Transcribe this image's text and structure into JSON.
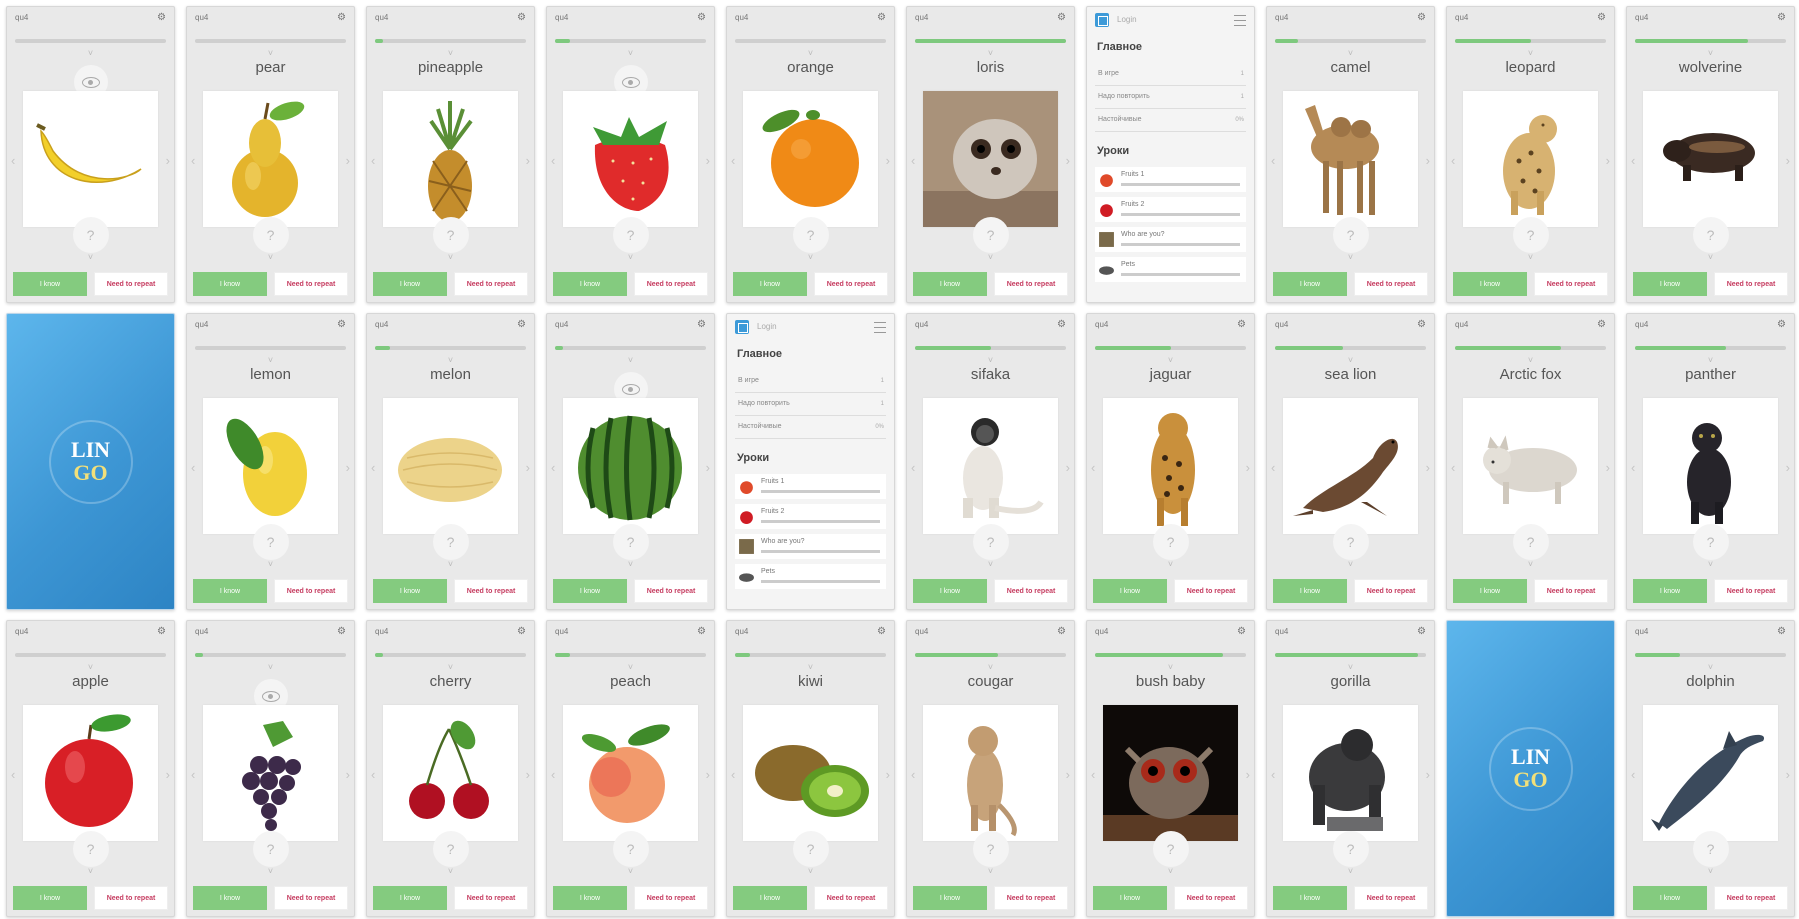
{
  "app": {
    "name": "LINGO",
    "logo_line1": "LIN",
    "logo_line2": "GO"
  },
  "status": {
    "carrier": "qu4",
    "settings_icon": "gear-icon"
  },
  "buttons": {
    "know": "I know",
    "repeat": "Need to repeat"
  },
  "colors": {
    "progress": "#7ec97e",
    "know_button": "#84cb7f",
    "repeat_text": "#c63c60",
    "splash": "#3d96d4"
  },
  "menu": {
    "login": "Login",
    "main_heading": "Главное",
    "rows": [
      {
        "label": "В игре",
        "count": "1"
      },
      {
        "label": "Надо повторить",
        "count": "1"
      },
      {
        "label": "Настойчивые",
        "count": "0%"
      }
    ],
    "lessons_heading": "Уроки",
    "lessons": [
      {
        "label": "Fruits 1",
        "icon": "strawberry-icon"
      },
      {
        "label": "Fruits 2",
        "icon": "apple-icon"
      },
      {
        "label": "Who are you?",
        "icon": "animal-icon"
      },
      {
        "label": "Pets",
        "icon": "rat-icon"
      }
    ]
  },
  "screens": [
    {
      "type": "card",
      "word": "",
      "image": "banana",
      "progress": 0.0
    },
    {
      "type": "card",
      "word": "pear",
      "image": "pear",
      "progress": 0.0
    },
    {
      "type": "card",
      "word": "pineapple",
      "image": "pineapple",
      "progress": 0.05
    },
    {
      "type": "card",
      "word": "",
      "image": "strawberry",
      "progress": 0.1
    },
    {
      "type": "card",
      "word": "orange",
      "image": "orange",
      "progress": 0.0
    },
    {
      "type": "card",
      "word": "loris",
      "image": "loris",
      "progress": 1.0
    },
    {
      "type": "menu"
    },
    {
      "type": "card",
      "word": "camel",
      "image": "camel",
      "progress": 0.15
    },
    {
      "type": "card",
      "word": "leopard",
      "image": "leopard",
      "progress": 0.5
    },
    {
      "type": "card",
      "word": "wolverine",
      "image": "wolverine",
      "progress": 0.75
    },
    {
      "type": "splash"
    },
    {
      "type": "card",
      "word": "lemon",
      "image": "lemon",
      "progress": 0.0
    },
    {
      "type": "card",
      "word": "melon",
      "image": "melon",
      "progress": 0.1
    },
    {
      "type": "card",
      "word": "",
      "image": "watermelon",
      "progress": 0.05
    },
    {
      "type": "menu"
    },
    {
      "type": "card",
      "word": "sifaka",
      "image": "sifaka",
      "progress": 0.5
    },
    {
      "type": "card",
      "word": "jaguar",
      "image": "jaguar",
      "progress": 0.5
    },
    {
      "type": "card",
      "word": "sea lion",
      "image": "sealion",
      "progress": 0.45
    },
    {
      "type": "card",
      "word": "Arctic fox",
      "image": "arcticfox",
      "progress": 0.7
    },
    {
      "type": "card",
      "word": "panther",
      "image": "panther",
      "progress": 0.6
    },
    {
      "type": "card",
      "word": "apple",
      "image": "apple",
      "progress": 0.0
    },
    {
      "type": "card",
      "word": "",
      "image": "grape",
      "progress": 0.05
    },
    {
      "type": "card",
      "word": "cherry",
      "image": "cherry",
      "progress": 0.05
    },
    {
      "type": "card",
      "word": "peach",
      "image": "peach",
      "progress": 0.1
    },
    {
      "type": "card",
      "word": "kiwi",
      "image": "kiwi",
      "progress": 0.1
    },
    {
      "type": "card",
      "word": "cougar",
      "image": "cougar",
      "progress": 0.55
    },
    {
      "type": "card",
      "word": "bush baby",
      "image": "bushbaby",
      "progress": 0.85
    },
    {
      "type": "card",
      "word": "gorilla",
      "image": "gorilla",
      "progress": 0.95
    },
    {
      "type": "splash"
    },
    {
      "type": "card",
      "word": "dolphin",
      "image": "dolphin",
      "progress": 0.3
    }
  ]
}
